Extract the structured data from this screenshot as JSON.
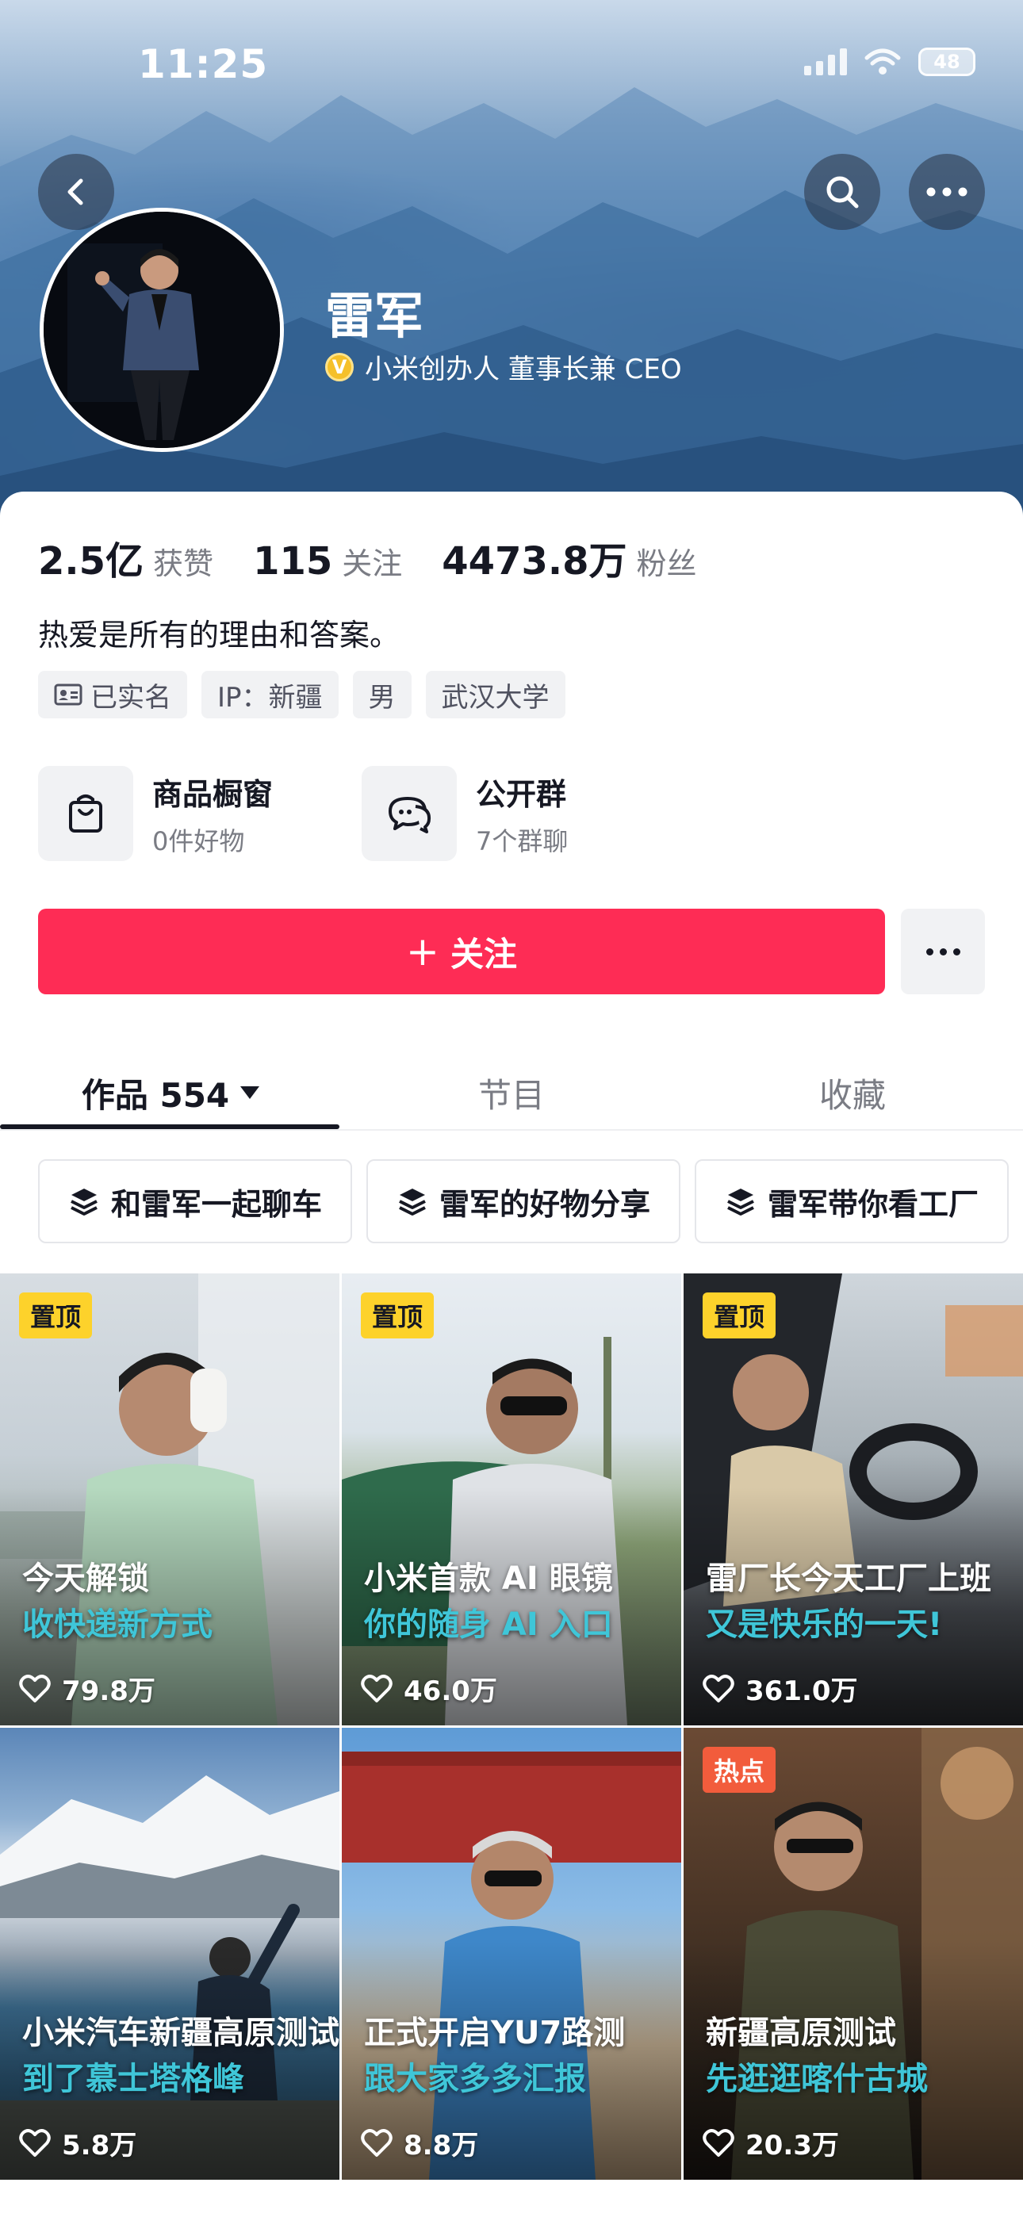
{
  "status_bar": {
    "time": "11:25",
    "battery": "48"
  },
  "profile": {
    "name": "雷军",
    "verified_badge": "V",
    "verification": "小米创办人 董事长兼 CEO",
    "bio": "热爱是所有的理由和答案。"
  },
  "stats": [
    {
      "value": "2.5亿",
      "label": "获赞"
    },
    {
      "value": "115",
      "label": "关注"
    },
    {
      "value": "4473.8万",
      "label": "粉丝"
    }
  ],
  "tags": [
    {
      "label": "已实名",
      "icon": "id-card-icon"
    },
    {
      "label": "IP：新疆"
    },
    {
      "label": "男"
    },
    {
      "label": "武汉大学"
    }
  ],
  "services": [
    {
      "title": "商品橱窗",
      "subtitle": "0件好物",
      "icon": "shopping-bag-icon"
    },
    {
      "title": "公开群",
      "subtitle": "7个群聊",
      "icon": "group-chat-icon"
    }
  ],
  "actions": {
    "follow_plus": "+",
    "follow_label": "关注"
  },
  "tabs": [
    {
      "label": "作品 554",
      "active": true
    },
    {
      "label": "节目",
      "active": false
    },
    {
      "label": "收藏",
      "active": false
    }
  ],
  "collections": [
    {
      "label": "和雷军一起聊车"
    },
    {
      "label": "雷军的好物分享"
    },
    {
      "label": "雷军带你看工厂"
    }
  ],
  "videos": [
    {
      "badge": "置顶",
      "badge_type": "pin",
      "title": "今天解锁",
      "subtitle": "收快递新方式",
      "likes": "79.8万"
    },
    {
      "badge": "置顶",
      "badge_type": "pin",
      "title": "小米首款 AI 眼镜",
      "subtitle": "你的随身 AI 入口",
      "likes": "46.0万"
    },
    {
      "badge": "置顶",
      "badge_type": "pin",
      "title": "雷厂长今天工厂上班",
      "subtitle": "又是快乐的一天!",
      "likes": "361.0万"
    },
    {
      "badge": "",
      "badge_type": "",
      "title": "小米汽车新疆高原测试",
      "subtitle": "到了慕士塔格峰",
      "likes": "5.8万"
    },
    {
      "badge": "",
      "badge_type": "",
      "title": "正式开启YU7路测",
      "subtitle": "跟大家多多汇报",
      "likes": "8.8万"
    },
    {
      "badge": "热点",
      "badge_type": "hot",
      "title": "新疆高原测试",
      "subtitle": "先逛逛喀什古城",
      "likes": "20.3万"
    }
  ],
  "colors": {
    "accent": "#fe2c55",
    "pin_badge": "#fdd22b",
    "hot_badge": "#f25c3c",
    "caption_highlight": "#3fc6d8"
  }
}
